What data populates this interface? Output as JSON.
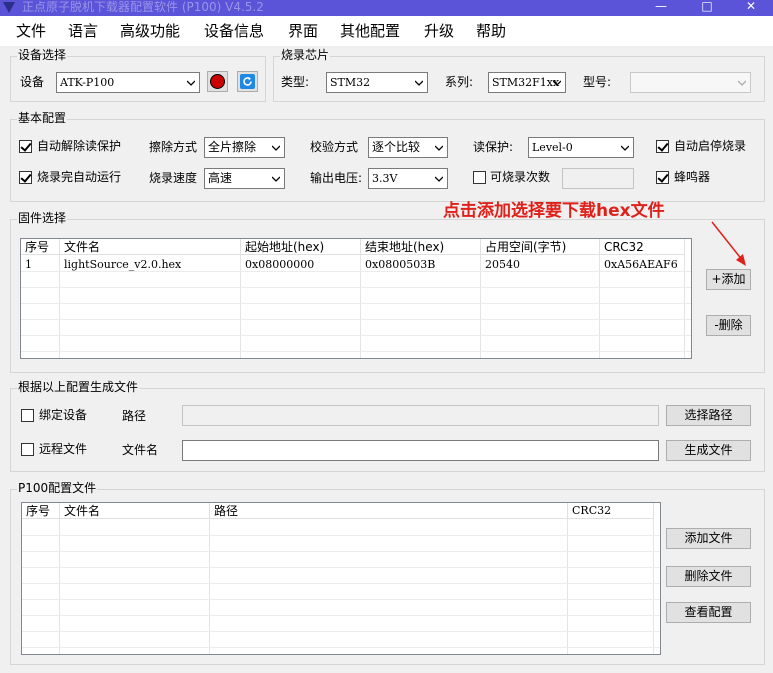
{
  "window": {
    "title": "正点原子脱机下载器配置软件 (P100)  V4.5.2",
    "minimize": "—",
    "maximize": "□",
    "close": "✕"
  },
  "menu": [
    "文件",
    "语言",
    "高级功能",
    "设备信息",
    "界面",
    "其他配置",
    "升级",
    "帮助"
  ],
  "device_select": {
    "title": "设备选择",
    "label": "设备",
    "value": "ATK-P100"
  },
  "chip": {
    "title": "烧录芯片",
    "type_label": "类型:",
    "type_value": "STM32",
    "series_label": "系列:",
    "series_value": "STM32F1xx",
    "model_label": "型号:",
    "model_value": ""
  },
  "basic": {
    "title": "基本配置",
    "auto_unlock": {
      "label": "自动解除读保护",
      "checked": true
    },
    "erase_label": "擦除方式",
    "erase_value": "全片擦除",
    "verify_label": "校验方式",
    "verify_value": "逐个比较",
    "readprot_label": "读保护:",
    "readprot_value": "Level-0",
    "auto_start": {
      "label": "自动启停烧录",
      "checked": true
    },
    "auto_run": {
      "label": "烧录完自动运行",
      "checked": true
    },
    "speed_label": "烧录速度",
    "speed_value": "高速",
    "voltage_label": "输出电压:",
    "voltage_value": "3.3V",
    "burn_count": {
      "label": "可烧录次数",
      "checked": false,
      "value": ""
    },
    "buzzer": {
      "label": "蜂鸣器",
      "checked": true
    }
  },
  "firmware": {
    "title": "固件选择",
    "annotation": "点击添加选择要下载hex文件",
    "columns": [
      "序号",
      "文件名",
      "起始地址(hex)",
      "结束地址(hex)",
      "占用空间(字节)",
      "CRC32"
    ],
    "rows": [
      [
        "1",
        "lightSource_v2.0.hex",
        "0x08000000",
        "0x0800503B",
        "20540",
        "0xA56AEAF6"
      ]
    ],
    "add_button": "+添加",
    "delete_button": "-删除"
  },
  "generate": {
    "title": "根据以上配置生成文件",
    "bind_device": {
      "label": "绑定设备",
      "checked": false
    },
    "path_label": "路径",
    "path_value": "",
    "choose_path_button": "选择路径",
    "remote_file": {
      "label": "远程文件",
      "checked": false
    },
    "filename_label": "文件名",
    "filename_value": "",
    "generate_button": "生成文件"
  },
  "p100": {
    "title": "P100配置文件",
    "columns": [
      "序号",
      "文件名",
      "路径",
      "CRC32"
    ],
    "rows": [],
    "add_file_button": "添加文件",
    "delete_file_button": "删除文件",
    "view_config_button": "查看配置"
  },
  "colors": {
    "titlebar": "#5b53d8",
    "annotation": "#e0201a",
    "record_button": "#cc0000",
    "refresh_icon": "#1e88e5"
  }
}
